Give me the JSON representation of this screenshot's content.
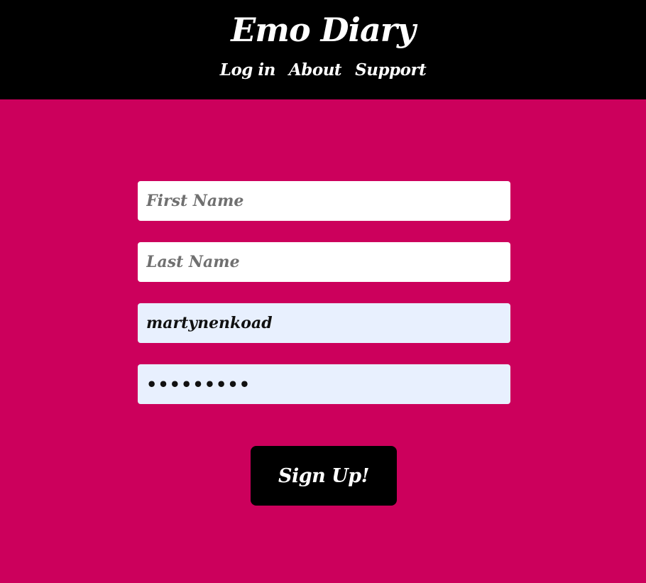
{
  "header": {
    "title": "Emo Diary",
    "nav": [
      {
        "label": "Log in"
      },
      {
        "label": "About"
      },
      {
        "label": "Support"
      }
    ]
  },
  "form": {
    "first_name": {
      "placeholder": "First Name",
      "value": ""
    },
    "last_name": {
      "placeholder": "Last Name",
      "value": ""
    },
    "username": {
      "value": "martynenkoad"
    },
    "password": {
      "value": "•••••••••"
    },
    "submit_label": "Sign Up!"
  },
  "colors": {
    "background": "#cc005c",
    "header": "#000000",
    "autofill": "#e8f0fe"
  }
}
